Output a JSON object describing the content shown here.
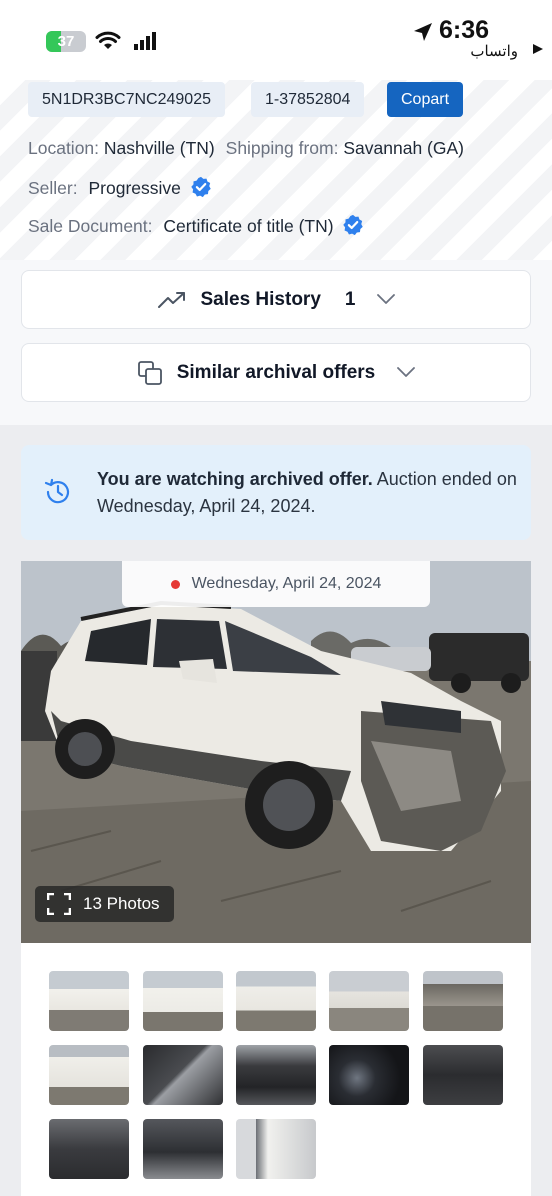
{
  "status_bar": {
    "battery": "37",
    "battery_level": 0.37,
    "time": "6:36",
    "back_app": "واتساب"
  },
  "listing": {
    "vin": "5N1DR3BC7NC249025",
    "lot": "1-37852804",
    "source": "Copart",
    "location_label": "Location:",
    "location_value": "Nashville (TN)",
    "shipping_label": "Shipping from:",
    "shipping_value": "Savannah (GA)",
    "seller_label": "Seller:",
    "seller_value": "Progressive",
    "doc_label": "Sale Document:",
    "doc_value": "Certificate of title (TN)"
  },
  "sections": {
    "sales_history_label": "Sales History",
    "sales_history_count": "1",
    "similar_label": "Similar archival offers"
  },
  "notice": {
    "bold": "You are watching archived offer.",
    "rest": " Auction ended on Wednesday, April 24, 2024."
  },
  "gallery": {
    "date": "Wednesday, April 24, 2024",
    "photos_label": "13 Photos"
  },
  "colors": {
    "accent": "#1565c0",
    "verified": "#2f80ed",
    "notice_bg": "#e3f0fb",
    "live_dot": "#e53935"
  }
}
